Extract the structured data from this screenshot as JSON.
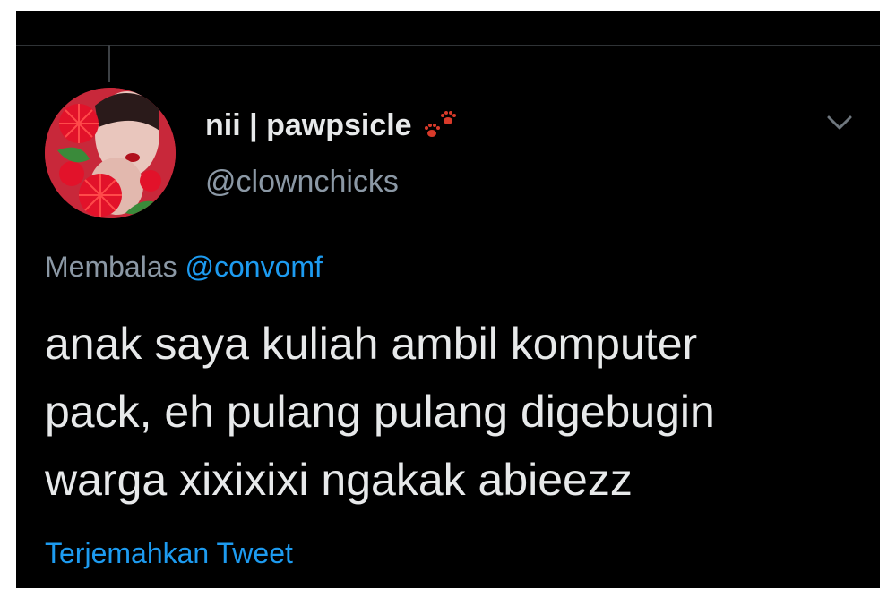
{
  "tweet": {
    "display_name": "nii | pawpsicle",
    "handle": "@clownchicks",
    "reply_prefix": "Membalas",
    "reply_mention": "@convomf",
    "text_lines": [
      "anak saya kuliah ambil komputer",
      "pack, eh pulang pulang digebugin",
      "warga xixixixi ngakak abieezz"
    ],
    "translate_label": "Terjemahkan Tweet"
  },
  "icons": {
    "name_emoji": "paw-prints-icon",
    "menu": "chevron-down-icon"
  },
  "colors": {
    "background": "#000000",
    "primary_text": "#e7e9ea",
    "secondary_text": "#8b98a5",
    "link": "#1d9bf0",
    "paw": "#d83a2a"
  }
}
